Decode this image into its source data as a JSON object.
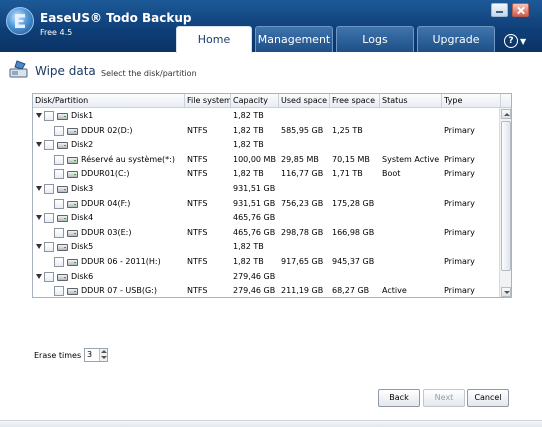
{
  "app": {
    "title": "EaseUS® Todo Backup",
    "version": "Free 4.5"
  },
  "tabs": [
    {
      "label": "Home",
      "active": true
    },
    {
      "label": "Management",
      "active": false
    },
    {
      "label": "Logs",
      "active": false
    },
    {
      "label": "Upgrade",
      "active": false
    }
  ],
  "help": {
    "label": "?",
    "caret": "▼"
  },
  "page": {
    "title": "Wipe data",
    "subtitle": "Select the disk/partition"
  },
  "table": {
    "headers": [
      "Disk/Partition",
      "File system",
      "Capacity",
      "Used space",
      "Free space",
      "Status",
      "Type"
    ],
    "rows": [
      {
        "kind": "disk",
        "name": "Disk1",
        "fs": "",
        "capacity": "1,82 TB",
        "used": "",
        "free": "",
        "status": "",
        "type": ""
      },
      {
        "kind": "partition",
        "name": "DDUR 02(D:)",
        "fs": "NTFS",
        "capacity": "1,82 TB",
        "used": "585,95 GB",
        "free": "1,25 TB",
        "status": "",
        "type": "Primary"
      },
      {
        "kind": "disk",
        "name": "Disk2",
        "fs": "",
        "capacity": "1,82 TB",
        "used": "",
        "free": "",
        "status": "",
        "type": ""
      },
      {
        "kind": "partition",
        "name": "Réservé au système(*:)",
        "fs": "NTFS",
        "capacity": "100,00 MB",
        "used": "29,85 MB",
        "free": "70,15 MB",
        "status": "System Active",
        "type": "Primary"
      },
      {
        "kind": "partition",
        "name": "DDUR01(C:)",
        "fs": "NTFS",
        "capacity": "1,82 TB",
        "used": "116,77 GB",
        "free": "1,71 TB",
        "status": "Boot",
        "type": "Primary"
      },
      {
        "kind": "disk",
        "name": "Disk3",
        "fs": "",
        "capacity": "931,51 GB",
        "used": "",
        "free": "",
        "status": "",
        "type": ""
      },
      {
        "kind": "partition",
        "name": "DDUR 04(F:)",
        "fs": "NTFS",
        "capacity": "931,51 GB",
        "used": "756,23 GB",
        "free": "175,28 GB",
        "status": "",
        "type": "Primary"
      },
      {
        "kind": "disk",
        "name": "Disk4",
        "fs": "",
        "capacity": "465,76 GB",
        "used": "",
        "free": "",
        "status": "",
        "type": ""
      },
      {
        "kind": "partition",
        "name": "DDUR 03(E:)",
        "fs": "NTFS",
        "capacity": "465,76 GB",
        "used": "298,78 GB",
        "free": "166,98 GB",
        "status": "",
        "type": "Primary"
      },
      {
        "kind": "disk",
        "name": "Disk5",
        "fs": "",
        "capacity": "1,82 TB",
        "used": "",
        "free": "",
        "status": "",
        "type": ""
      },
      {
        "kind": "partition",
        "name": "DDUR 06 - 2011(H:)",
        "fs": "NTFS",
        "capacity": "1,82 TB",
        "used": "917,65 GB",
        "free": "945,37 GB",
        "status": "",
        "type": "Primary"
      },
      {
        "kind": "disk",
        "name": "Disk6",
        "fs": "",
        "capacity": "279,46 GB",
        "used": "",
        "free": "",
        "status": "",
        "type": ""
      },
      {
        "kind": "partition",
        "name": "DDUR 07 - USB(G:)",
        "fs": "NTFS",
        "capacity": "279,46 GB",
        "used": "211,19 GB",
        "free": "68,27 GB",
        "status": "Active",
        "type": "Primary"
      }
    ]
  },
  "erase": {
    "label": "Erase times",
    "value": "3"
  },
  "buttons": {
    "back": "Back",
    "next": "Next",
    "cancel": "Cancel"
  },
  "colors": {
    "header_blue": "#0f3f78",
    "title_blue": "#1b3a66"
  },
  "icons": {
    "app": "easeus-logo-icon",
    "wipe": "wipe-data-icon",
    "disk": "disk-icon"
  }
}
